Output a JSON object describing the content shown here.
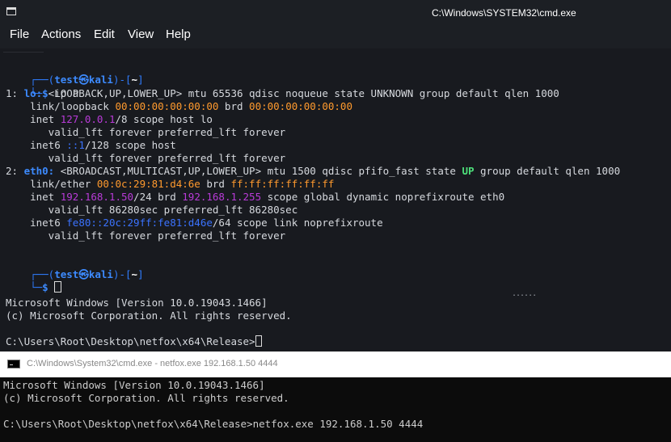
{
  "kali_window": {
    "title": "C:\\Windows\\SYSTEM32\\cmd.exe",
    "menu": [
      "File",
      "Actions",
      "Edit",
      "View",
      "Help"
    ],
    "prompt": {
      "top": "┌──(",
      "user_host_user": "test",
      "at": "㉿",
      "host": "kali",
      "close": ")-[",
      "dir": "~",
      "end": "]",
      "bottom": "└─",
      "dollar": "$",
      "command": "ip a"
    },
    "lo": {
      "idx": "1: ",
      "name": "lo:",
      "flags": " <LOOPBACK,UP,LOWER_UP> mtu 65536 qdisc noqueue state UNKNOWN group default qlen 1000",
      "link_prefix": "    link/loopback ",
      "link_mac": "00:00:00:00:00:00",
      "brd_label": " brd ",
      "brd_mac": "00:00:00:00:00:00",
      "inet_prefix": "    inet ",
      "inet_addr": "127.0.0.1",
      "inet_rest": "/8 scope host lo",
      "valid1": "       valid_lft forever preferred_lft forever",
      "inet6_prefix": "    inet6 ",
      "inet6_addr": "::1",
      "inet6_rest": "/128 scope host",
      "valid2": "       valid_lft forever preferred_lft forever"
    },
    "eth0": {
      "idx": "2: ",
      "name": "eth0:",
      "flags_a": " <BROADCAST,MULTICAST,UP,LOWER_UP> mtu 1500 qdisc pfifo_fast state ",
      "state": "UP",
      "flags_b": " group default qlen 1000",
      "link_prefix": "    link/ether ",
      "link_mac": "00:0c:29:81:d4:6e",
      "brd_label": " brd ",
      "brd_mac": "ff:ff:ff:ff:ff:ff",
      "inet_prefix": "    inet ",
      "inet_addr": "192.168.1.50",
      "inet_mid": "/24 brd ",
      "inet_brd": "192.168.1.255",
      "inet_rest": " scope global dynamic noprefixroute eth0",
      "valid1": "       valid_lft 86280sec preferred_lft 86280sec",
      "inet6_prefix": "    inet6 ",
      "inet6_addr": "fe80::20c:29ff:fe81:d46e",
      "inet6_rest": "/64 scope link noprefixroute",
      "valid2": "       valid_lft forever preferred_lft forever"
    },
    "win_version": "Microsoft Windows [Version 10.0.19043.1466]",
    "win_copyright": "(c) Microsoft Corporation. All rights reserved.",
    "cmd_prompt": "C:\\Users\\Root\\Desktop\\netfox\\x64\\Release>",
    "dots": "......"
  },
  "cmd_window": {
    "title": "C:\\Windows\\System32\\cmd.exe - netfox.exe  192.168.1.50 4444",
    "version": "Microsoft Windows [Version 10.0.19043.1466]",
    "copyright": "(c) Microsoft Corporation. All rights reserved.",
    "prompt": "C:\\Users\\Root\\Desktop\\netfox\\x64\\Release>",
    "command": "netfox.exe 192.168.1.50 4444"
  },
  "colors": {
    "prompt_blue": "#2f7dff",
    "user_blue": "#3d8bff",
    "mac_orange": "#ff9a2e",
    "ip_purple": "#b93bd8",
    "ipv6_blue": "#3b73ff",
    "state_green": "#4de07a"
  }
}
